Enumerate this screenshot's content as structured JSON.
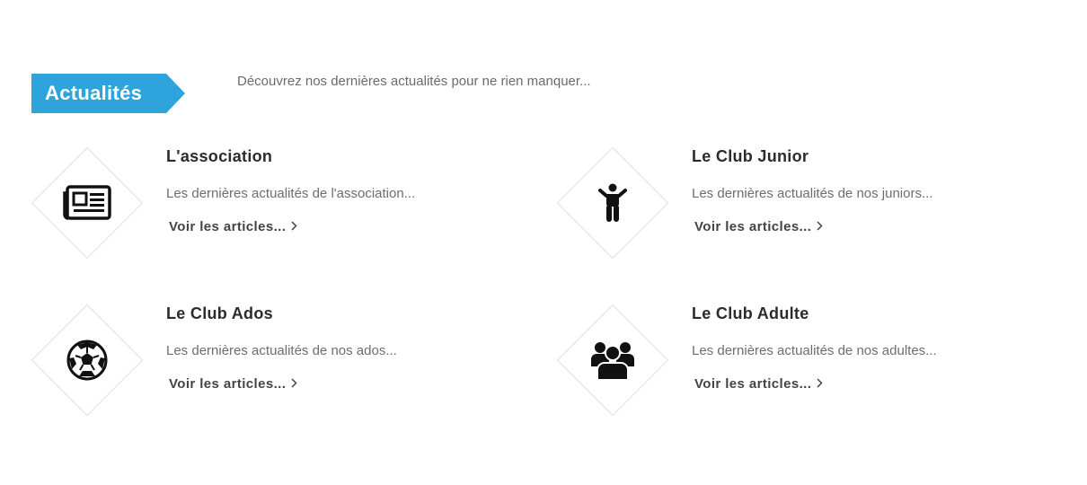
{
  "header": {
    "tag_label": "Actualités",
    "tag_color": "#2fa4dc",
    "intro": "Découvrez nos dernières actualités pour ne rien manquer..."
  },
  "cards": [
    {
      "title": "L'association",
      "description": "Les dernières actualités de l'association...",
      "link": "Voir les articles...",
      "icon": "newspaper-icon"
    },
    {
      "title": "Le Club Junior",
      "description": "Les dernières actualités de nos juniors...",
      "link": "Voir les articles...",
      "icon": "child-icon"
    },
    {
      "title": "Le Club Ados",
      "description": "Les dernières actualités de nos ados...",
      "link": "Voir les articles...",
      "icon": "soccer-ball-icon"
    },
    {
      "title": "Le Club Adulte",
      "description": "Les dernières actualités de nos adultes...",
      "link": "Voir les articles...",
      "icon": "group-icon"
    }
  ]
}
